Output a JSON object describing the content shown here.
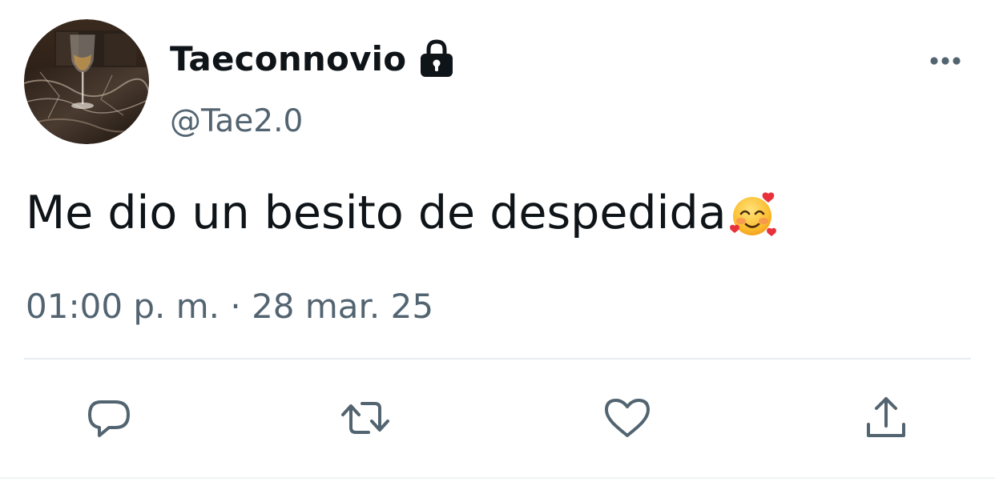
{
  "user": {
    "display_name": "Taeconnovio",
    "handle": "@Tae2.0",
    "protected_icon": "lock-icon",
    "avatar": "avatar-photo-wine-glass"
  },
  "tweet": {
    "text": "Me dio un besito de despedida",
    "emoji": "smiling-face-with-hearts",
    "timestamp": "01:00 p. m. · 28 mar. 25"
  },
  "actions": {
    "more": "more-icon",
    "reply": "reply-icon",
    "retweet": "retweet-icon",
    "like": "heart-icon",
    "share": "share-icon"
  },
  "colors": {
    "text_primary": "#0f1419",
    "text_secondary": "#536471",
    "divider": "#e6ecf0",
    "icon": "#536471",
    "background": "#ffffff"
  }
}
